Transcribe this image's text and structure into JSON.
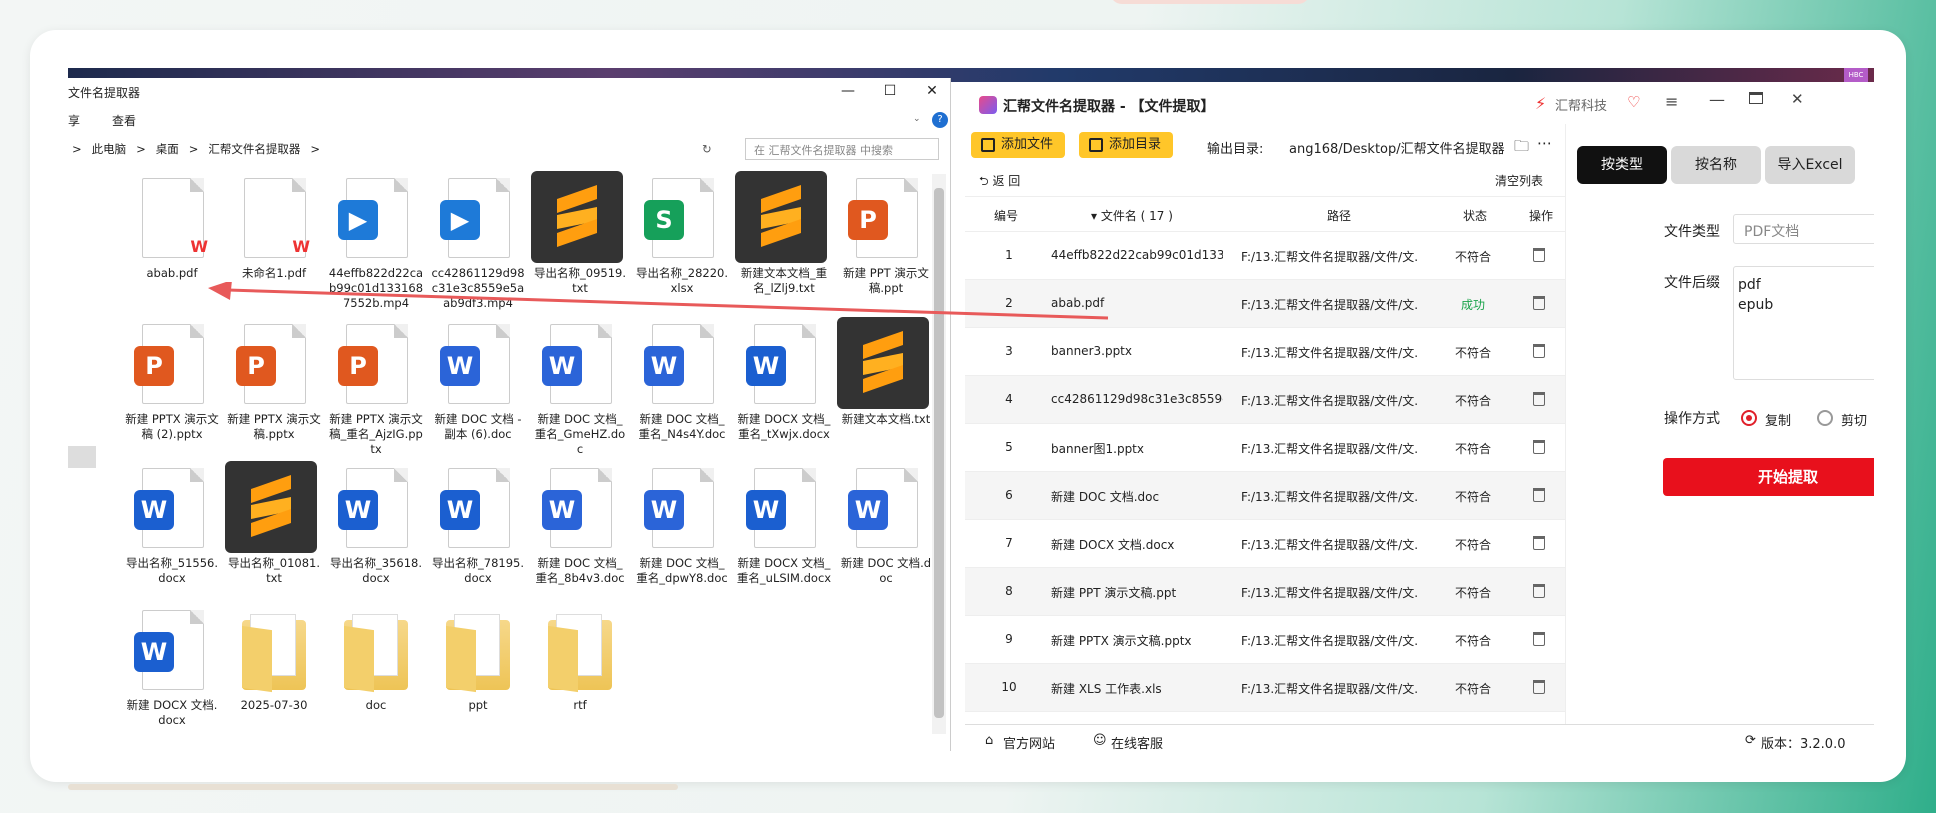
{
  "explorer": {
    "title": "文件名提取器",
    "ribbon": [
      "享",
      "查看"
    ],
    "breadcrumb": [
      ">",
      "此电脑",
      ">",
      "桌面",
      ">",
      "汇帮文件名提取器",
      ">"
    ],
    "search_placeholder": "在 汇帮文件名提取器 中搜索",
    "win": {
      "min": "—",
      "max": "☐",
      "close": "✕"
    },
    "files": [
      {
        "name": "abab.pdf",
        "type": "pdf"
      },
      {
        "name": "未命名1.pdf",
        "type": "pdf"
      },
      {
        "name": "44effb822d22cab99c01d1331687552b.mp4",
        "type": "mp4"
      },
      {
        "name": "cc42861129d98c31e3c8559e5aab9df3.mp4",
        "type": "mp4"
      },
      {
        "name": "导出名称_09519.txt",
        "type": "txt"
      },
      {
        "name": "导出名称_28220.xlsx",
        "type": "xlsx"
      },
      {
        "name": "新建文本文档_重名_lZlj9.txt",
        "type": "txt"
      },
      {
        "name": "新建 PPT 演示文稿.ppt",
        "type": "ppt"
      },
      {
        "name": "新建 PPTX 演示文稿 (2).pptx",
        "type": "pptx"
      },
      {
        "name": "新建 PPTX 演示文稿.pptx",
        "type": "pptx"
      },
      {
        "name": "新建 PPTX 演示文稿_重名_AjzIG.pptx",
        "type": "pptx"
      },
      {
        "name": "新建 DOC 文档 - 副本 (6).doc",
        "type": "doc"
      },
      {
        "name": "新建 DOC 文档_重名_GmeHZ.doc",
        "type": "doc"
      },
      {
        "name": "新建 DOC 文档_重名_N4s4Y.doc",
        "type": "doc"
      },
      {
        "name": "新建 DOCX 文档_重名_tXwjx.docx",
        "type": "docx"
      },
      {
        "name": "新建文本文档.txt",
        "type": "txt"
      },
      {
        "name": "导出名称_51556.docx",
        "type": "docx"
      },
      {
        "name": "导出名称_01081.txt",
        "type": "txt"
      },
      {
        "name": "导出名称_35618.docx",
        "type": "docx"
      },
      {
        "name": "导出名称_78195.docx",
        "type": "docx"
      },
      {
        "name": "新建 DOC 文档_重名_8b4v3.doc",
        "type": "doc"
      },
      {
        "name": "新建 DOC 文档_重名_dpwY8.doc",
        "type": "doc"
      },
      {
        "name": "新建 DOCX 文档_重名_uLSIM.docx",
        "type": "docx"
      },
      {
        "name": "新建 DOC 文档.doc",
        "type": "doc"
      },
      {
        "name": "新建 DOCX 文档.docx",
        "type": "docx"
      },
      {
        "name": "2025-07-30",
        "type": "folder"
      },
      {
        "name": "doc",
        "type": "folder"
      },
      {
        "name": "ppt",
        "type": "folder"
      },
      {
        "name": "rtf",
        "type": "folder"
      }
    ]
  },
  "app": {
    "title": "汇帮文件名提取器 - 【文件提取】",
    "brand": "汇帮科技",
    "add_file": "添加文件",
    "add_dir": "添加目录",
    "output_label": "输出目录:",
    "output_path": "ang168/Desktop/汇帮文件名提取器",
    "back": "返  回",
    "clear": "清空列表",
    "headers": {
      "num": "编号",
      "name": "▾ 文件名 ( 17 )",
      "path": "路径",
      "status": "状态",
      "op": "操作"
    },
    "rows": [
      {
        "num": "1",
        "name": "44effb822d22cab99c01d1331...",
        "path": "F:/13.汇帮文件名提取器/文件/文...",
        "status": "不符合"
      },
      {
        "num": "2",
        "name": "abab.pdf",
        "path": "F:/13.汇帮文件名提取器/文件/文...",
        "status": "成功"
      },
      {
        "num": "3",
        "name": "banner3.pptx",
        "path": "F:/13.汇帮文件名提取器/文件/文...",
        "status": "不符合"
      },
      {
        "num": "4",
        "name": "cc42861129d98c31e3c8559e5...",
        "path": "F:/13.汇帮文件名提取器/文件/文...",
        "status": "不符合"
      },
      {
        "num": "5",
        "name": "banner图1.pptx",
        "path": "F:/13.汇帮文件名提取器/文件/文...",
        "status": "不符合"
      },
      {
        "num": "6",
        "name": "新建 DOC 文档.doc",
        "path": "F:/13.汇帮文件名提取器/文件/文...",
        "status": "不符合"
      },
      {
        "num": "7",
        "name": "新建 DOCX 文档.docx",
        "path": "F:/13.汇帮文件名提取器/文件/文...",
        "status": "不符合"
      },
      {
        "num": "8",
        "name": "新建 PPT 演示文稿.ppt",
        "path": "F:/13.汇帮文件名提取器/文件/文...",
        "status": "不符合"
      },
      {
        "num": "9",
        "name": "新建 PPTX 演示文稿.pptx",
        "path": "F:/13.汇帮文件名提取器/文件/文...",
        "status": "不符合"
      },
      {
        "num": "10",
        "name": "新建 XLS 工作表.xls",
        "path": "F:/13.汇帮文件名提取器/文件/文...",
        "status": "不符合"
      }
    ],
    "tabs": [
      "按类型",
      "按名称",
      "导入Excel"
    ],
    "file_type_label": "文件类型",
    "file_type_value": "PDF文档",
    "suffix_label": "文件后缀",
    "suffix_value": "pdf\nepub",
    "op_label": "操作方式",
    "op_copy": "复制",
    "op_cut": "剪切",
    "start": "开始提取",
    "site": "官方网站",
    "support": "在线客服",
    "version": "版本：3.2.0.0",
    "hbc": "HBC"
  },
  "colors": {
    "accent": "#ffc629",
    "start": "#e8101c",
    "success": "#1aa34a"
  }
}
